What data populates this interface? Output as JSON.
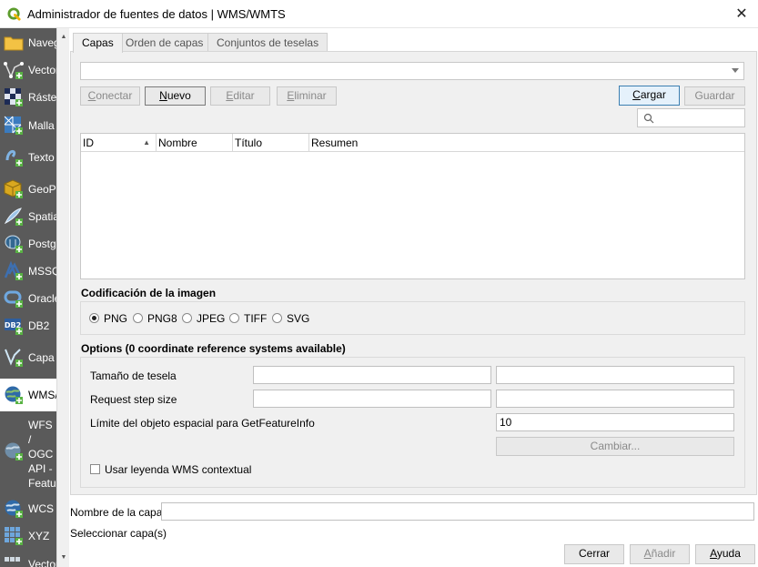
{
  "window": {
    "title": "Administrador de fuentes de datos | WMS/WMTS",
    "close_glyph": "✕"
  },
  "sidebar": {
    "items": [
      {
        "label": "Navegador",
        "icon": "folder-icon"
      },
      {
        "label": "Vectorial",
        "icon": "vector-icon"
      },
      {
        "label": "Ráster",
        "icon": "raster-icon"
      },
      {
        "label": "Malla",
        "icon": "mesh-icon"
      },
      {
        "label": "Texto",
        "icon": "delimited-text-icon"
      },
      {
        "label": "GeoPackage",
        "icon": "geopackage-icon"
      },
      {
        "label": "SpatiaLite",
        "icon": "spatialite-icon"
      },
      {
        "label": "PostgreSQL",
        "icon": "postgis-icon"
      },
      {
        "label": "MSSQL",
        "icon": "mssql-icon"
      },
      {
        "label": "Oracle",
        "icon": "oracle-icon"
      },
      {
        "label": "DB2",
        "icon": "db2-icon"
      },
      {
        "label": "Capa virtual",
        "icon": "virtual-layer-icon"
      },
      {
        "label": "WMS/WMTS",
        "icon": "wms-icon"
      },
      {
        "label": "WFS / OGC API - Features",
        "icon": "wfs-icon"
      },
      {
        "label": "WCS",
        "icon": "wcs-icon"
      },
      {
        "label": "XYZ",
        "icon": "xyz-icon"
      },
      {
        "label": "Vector tiles",
        "icon": "vector-tiles-icon"
      }
    ]
  },
  "tabs": [
    {
      "label": "Capas"
    },
    {
      "label": "Orden de capas"
    },
    {
      "label": "Conjuntos de teselas"
    }
  ],
  "connection": {
    "selected": "",
    "buttons": {
      "connect": "Conectar",
      "new": "Nuevo",
      "edit": "Editar",
      "remove": "Eliminar",
      "load": "Cargar",
      "save": "Guardar"
    }
  },
  "search": {
    "placeholder": ""
  },
  "table": {
    "columns": [
      "ID",
      "Nombre",
      "Título",
      "Resumen"
    ]
  },
  "image_encoding": {
    "title": "Codificación de la imagen",
    "options": [
      "PNG",
      "PNG8",
      "JPEG",
      "TIFF",
      "SVG"
    ],
    "selected": "PNG"
  },
  "options": {
    "title": "Options (0 coordinate reference systems available)",
    "tile_size_label": "Tamaño de tesela",
    "request_step_label": "Request step size",
    "feature_limit_label": "Límite del objeto espacial para GetFeatureInfo",
    "feature_limit_value": "10",
    "change_button": "Cambiar...",
    "contextual_legend_label": "Usar leyenda WMS contextual"
  },
  "layer_name": {
    "label": "Nombre de la capa",
    "value": ""
  },
  "status": "Seleccionar capa(s)",
  "footer": {
    "close": "Cerrar",
    "add": "Añadir",
    "help": "Ayuda"
  }
}
